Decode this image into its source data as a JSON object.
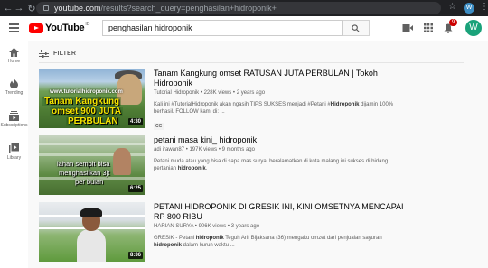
{
  "browser": {
    "url_host": "youtube.com",
    "url_path": "/results?search_query=penghasilan+hidroponik+",
    "profile_initial": "W"
  },
  "header": {
    "logo_text": "YouTube",
    "logo_region": "ID",
    "search_value": "penghasilan hidroponik",
    "notification_count": "9",
    "avatar_initial": "W"
  },
  "sidebar": {
    "items": [
      {
        "label": "Home",
        "icon": "home-icon"
      },
      {
        "label": "Trending",
        "icon": "trending-icon"
      },
      {
        "label": "Subscriptions",
        "icon": "subscriptions-icon"
      },
      {
        "label": "Library",
        "icon": "library-icon"
      }
    ]
  },
  "filter": {
    "label": "FILTER"
  },
  "results": [
    {
      "title": "Tanam Kangkung omset RATUSAN JUTA PERBULAN | Tokoh Hidroponik",
      "channel": "Tutorial Hidroponik",
      "views": "228K views",
      "age": "2 years ago",
      "desc_1": "Kali ini #TutorialHidroponik akan ngasih TIPS SUKSES menjadi #Petani #",
      "desc_bold": "Hidroponik",
      "desc_2": " dijamin 100% berhasil. FOLLOW kami di: ...",
      "badge": "CC",
      "duration": "4:30",
      "thumb_url_text": "www.tutorialhidroponik.com",
      "thumb_caption_1": "Tanam Kangkung",
      "thumb_caption_2": "omset 900 JUTA",
      "thumb_caption_3": "PERBULAN"
    },
    {
      "title": "petani masa kini_ hidroponik",
      "channel": "adi irawan87",
      "views": "197K views",
      "age": "9 months ago",
      "desc_1": "Petani muda atau yang bisa di sapa mas surya, beralamatkan di kota malang ini sukses di bidang pertanian ",
      "desc_bold": "hidroponik",
      "desc_2": ".",
      "duration": "6:25",
      "thumb_caption_1": "lahan sempit bisa",
      "thumb_caption_2": "menghasilkan 3jt",
      "thumb_caption_3": "per bulan"
    },
    {
      "title": "PETANI HIDROPONIK DI GRESIK INI, KINI OMSETNYA MENCAPAI RP 800 RIBU",
      "channel": "HARIAN SURYA",
      "views": "906K views",
      "age": "3 years ago",
      "desc_1": "GRESIK - Petani ",
      "desc_bold": "hidroponik",
      "desc_2": " Teguh Arif Bijaksana (36) mengaku omzet dari penjualan sayuran ",
      "desc_bold_2": "hidroponik",
      "desc_3": " dalam kurun waktu ...",
      "duration": "8:36"
    }
  ]
}
